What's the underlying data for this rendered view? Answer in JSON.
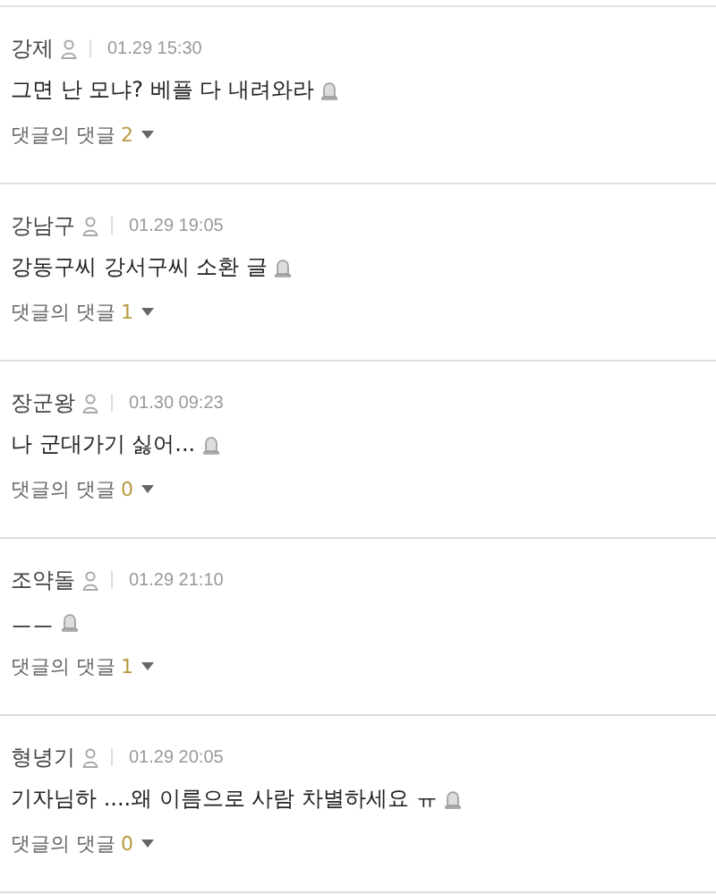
{
  "comments": [
    {
      "author": "강제",
      "time": "01.29 15:30",
      "text": "그면 난 모냐? 베플 다 내려와라",
      "reply_label": "댓글의 댓글",
      "reply_count": "2"
    },
    {
      "author": "강남구",
      "time": "01.29 19:05",
      "text": "강동구씨 강서구씨 소환 글",
      "reply_label": "댓글의 댓글",
      "reply_count": "1"
    },
    {
      "author": "장군왕",
      "time": "01.30 09:23",
      "text": "나 군대가기 싫어...",
      "reply_label": "댓글의 댓글",
      "reply_count": "0"
    },
    {
      "author": "조약돌",
      "time": "01.29 21:10",
      "text": "ㅡㅡ",
      "reply_label": "댓글의 댓글",
      "reply_count": "1"
    },
    {
      "author": "형녕기",
      "time": "01.29 20:05",
      "text": "기자님하 ....왜 이름으로 사람 차별하세요 ㅠ",
      "reply_label": "댓글의 댓글",
      "reply_count": "0"
    }
  ]
}
